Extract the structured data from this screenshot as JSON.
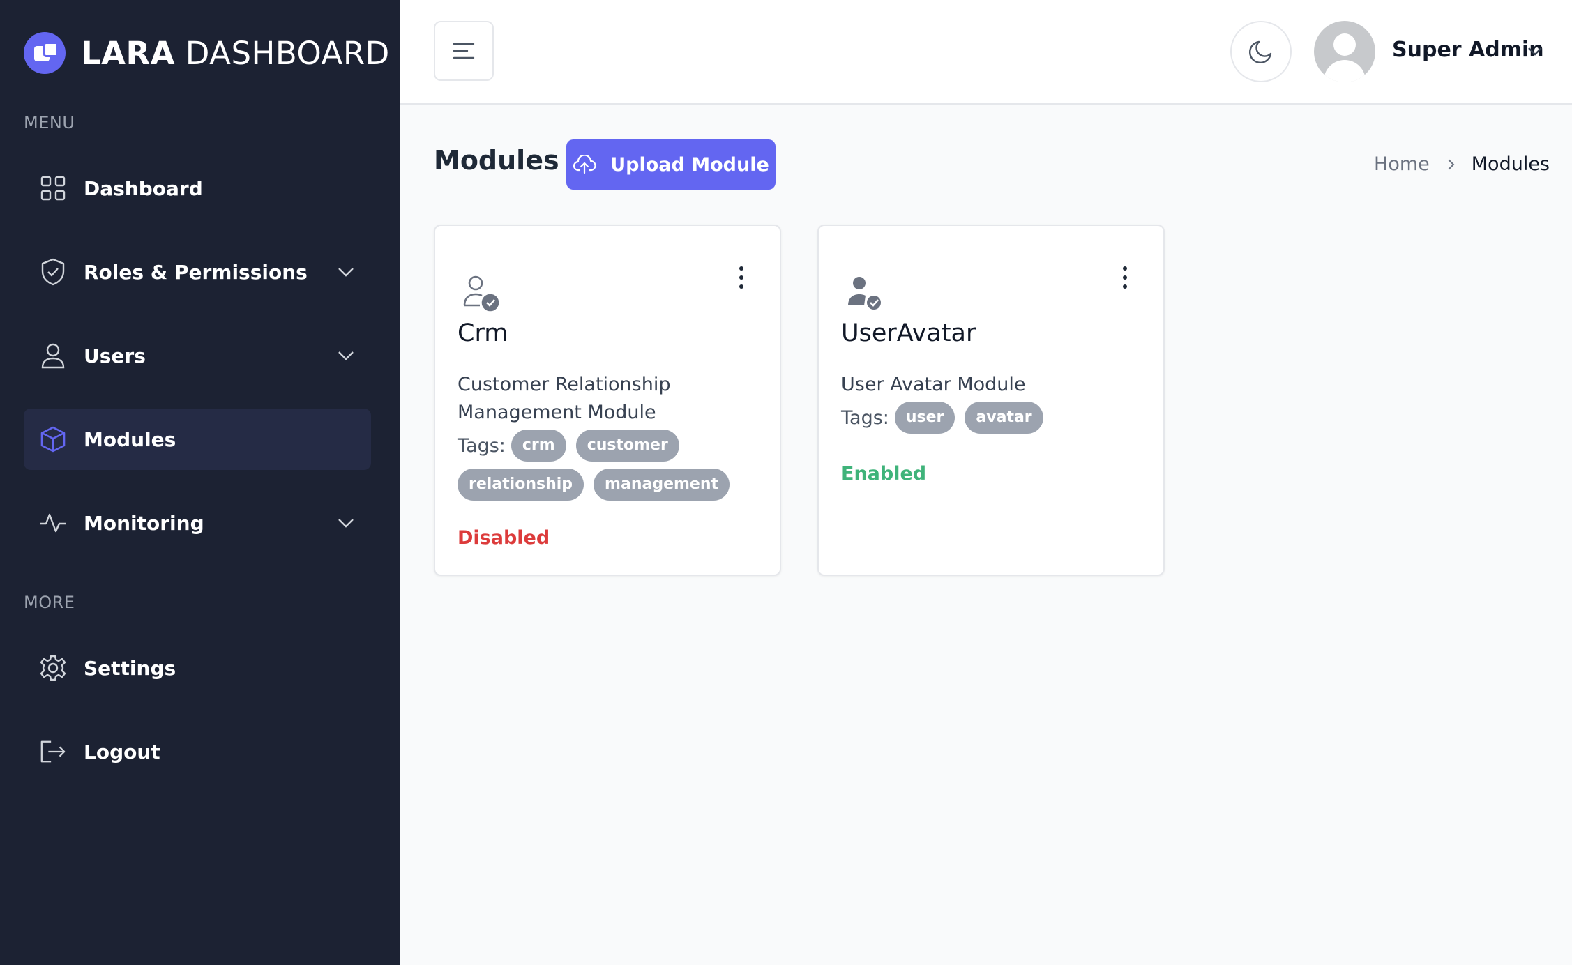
{
  "app": {
    "logo_bold": "LARA",
    "logo_light": "DASHBOARD"
  },
  "sidebar": {
    "menu_label": "MENU",
    "more_label": "MORE",
    "items": [
      {
        "label": "Dashboard",
        "icon": "grid-icon"
      },
      {
        "label": "Roles & Permissions",
        "icon": "shield-check-icon"
      },
      {
        "label": "Users",
        "icon": "user-icon"
      },
      {
        "label": "Modules",
        "icon": "cube-icon",
        "active": true
      },
      {
        "label": "Monitoring",
        "icon": "activity-icon"
      }
    ],
    "more_items": [
      {
        "label": "Settings",
        "icon": "gear-icon"
      },
      {
        "label": "Logout",
        "icon": "logout-icon"
      }
    ]
  },
  "header": {
    "user_name": "Super Admin"
  },
  "page": {
    "title": "Modules",
    "upload_label": "Upload Module",
    "breadcrumb": {
      "home": "Home",
      "current": "Modules"
    }
  },
  "modules": [
    {
      "title": "Crm",
      "description": "Customer Relationship Management Module",
      "tags_label": "Tags:",
      "tags": [
        "crm",
        "customer",
        "relationship",
        "management"
      ],
      "status": "Disabled"
    },
    {
      "title": "UserAvatar",
      "description": "User Avatar Module",
      "tags_label": "Tags:",
      "tags": [
        "user",
        "avatar"
      ],
      "status": "Enabled"
    }
  ],
  "colors": {
    "sidebar_bg": "#1c2233",
    "accent": "#6366f1",
    "disabled": "#dc3b3b",
    "enabled": "#3fb37a"
  }
}
